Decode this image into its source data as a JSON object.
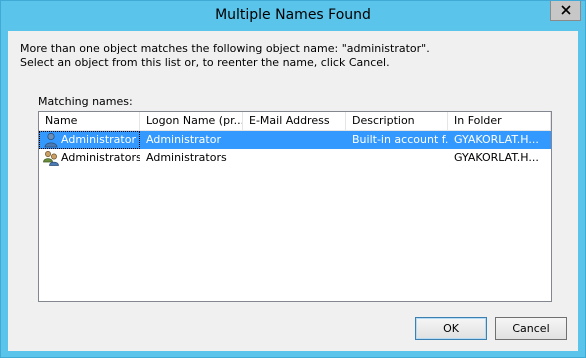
{
  "window": {
    "title": "Multiple Names Found"
  },
  "message": {
    "line1": "More than one object matches the following object name: \"administrator\".",
    "line2": "Select an object from this list or, to reenter the name, click Cancel."
  },
  "list": {
    "label": "Matching names:",
    "columns": [
      "Name",
      "Logon Name (pr...",
      "E-Mail Address",
      "Description",
      "In Folder"
    ],
    "rows": [
      {
        "icon": "user-icon",
        "name": "Administrator",
        "logon": "Administrator",
        "email": "",
        "description": "Built-in account f...",
        "folder": "GYAKORLAT.H...",
        "selected": true
      },
      {
        "icon": "group-icon",
        "name": "Administrators",
        "logon": "Administrators",
        "email": "",
        "description": "",
        "folder": "GYAKORLAT.H...",
        "selected": false
      }
    ]
  },
  "buttons": {
    "ok": "OK",
    "cancel": "Cancel"
  },
  "colors": {
    "frame": "#5bc4eb",
    "selection": "#3399ff",
    "client": "#f0f0f0"
  }
}
